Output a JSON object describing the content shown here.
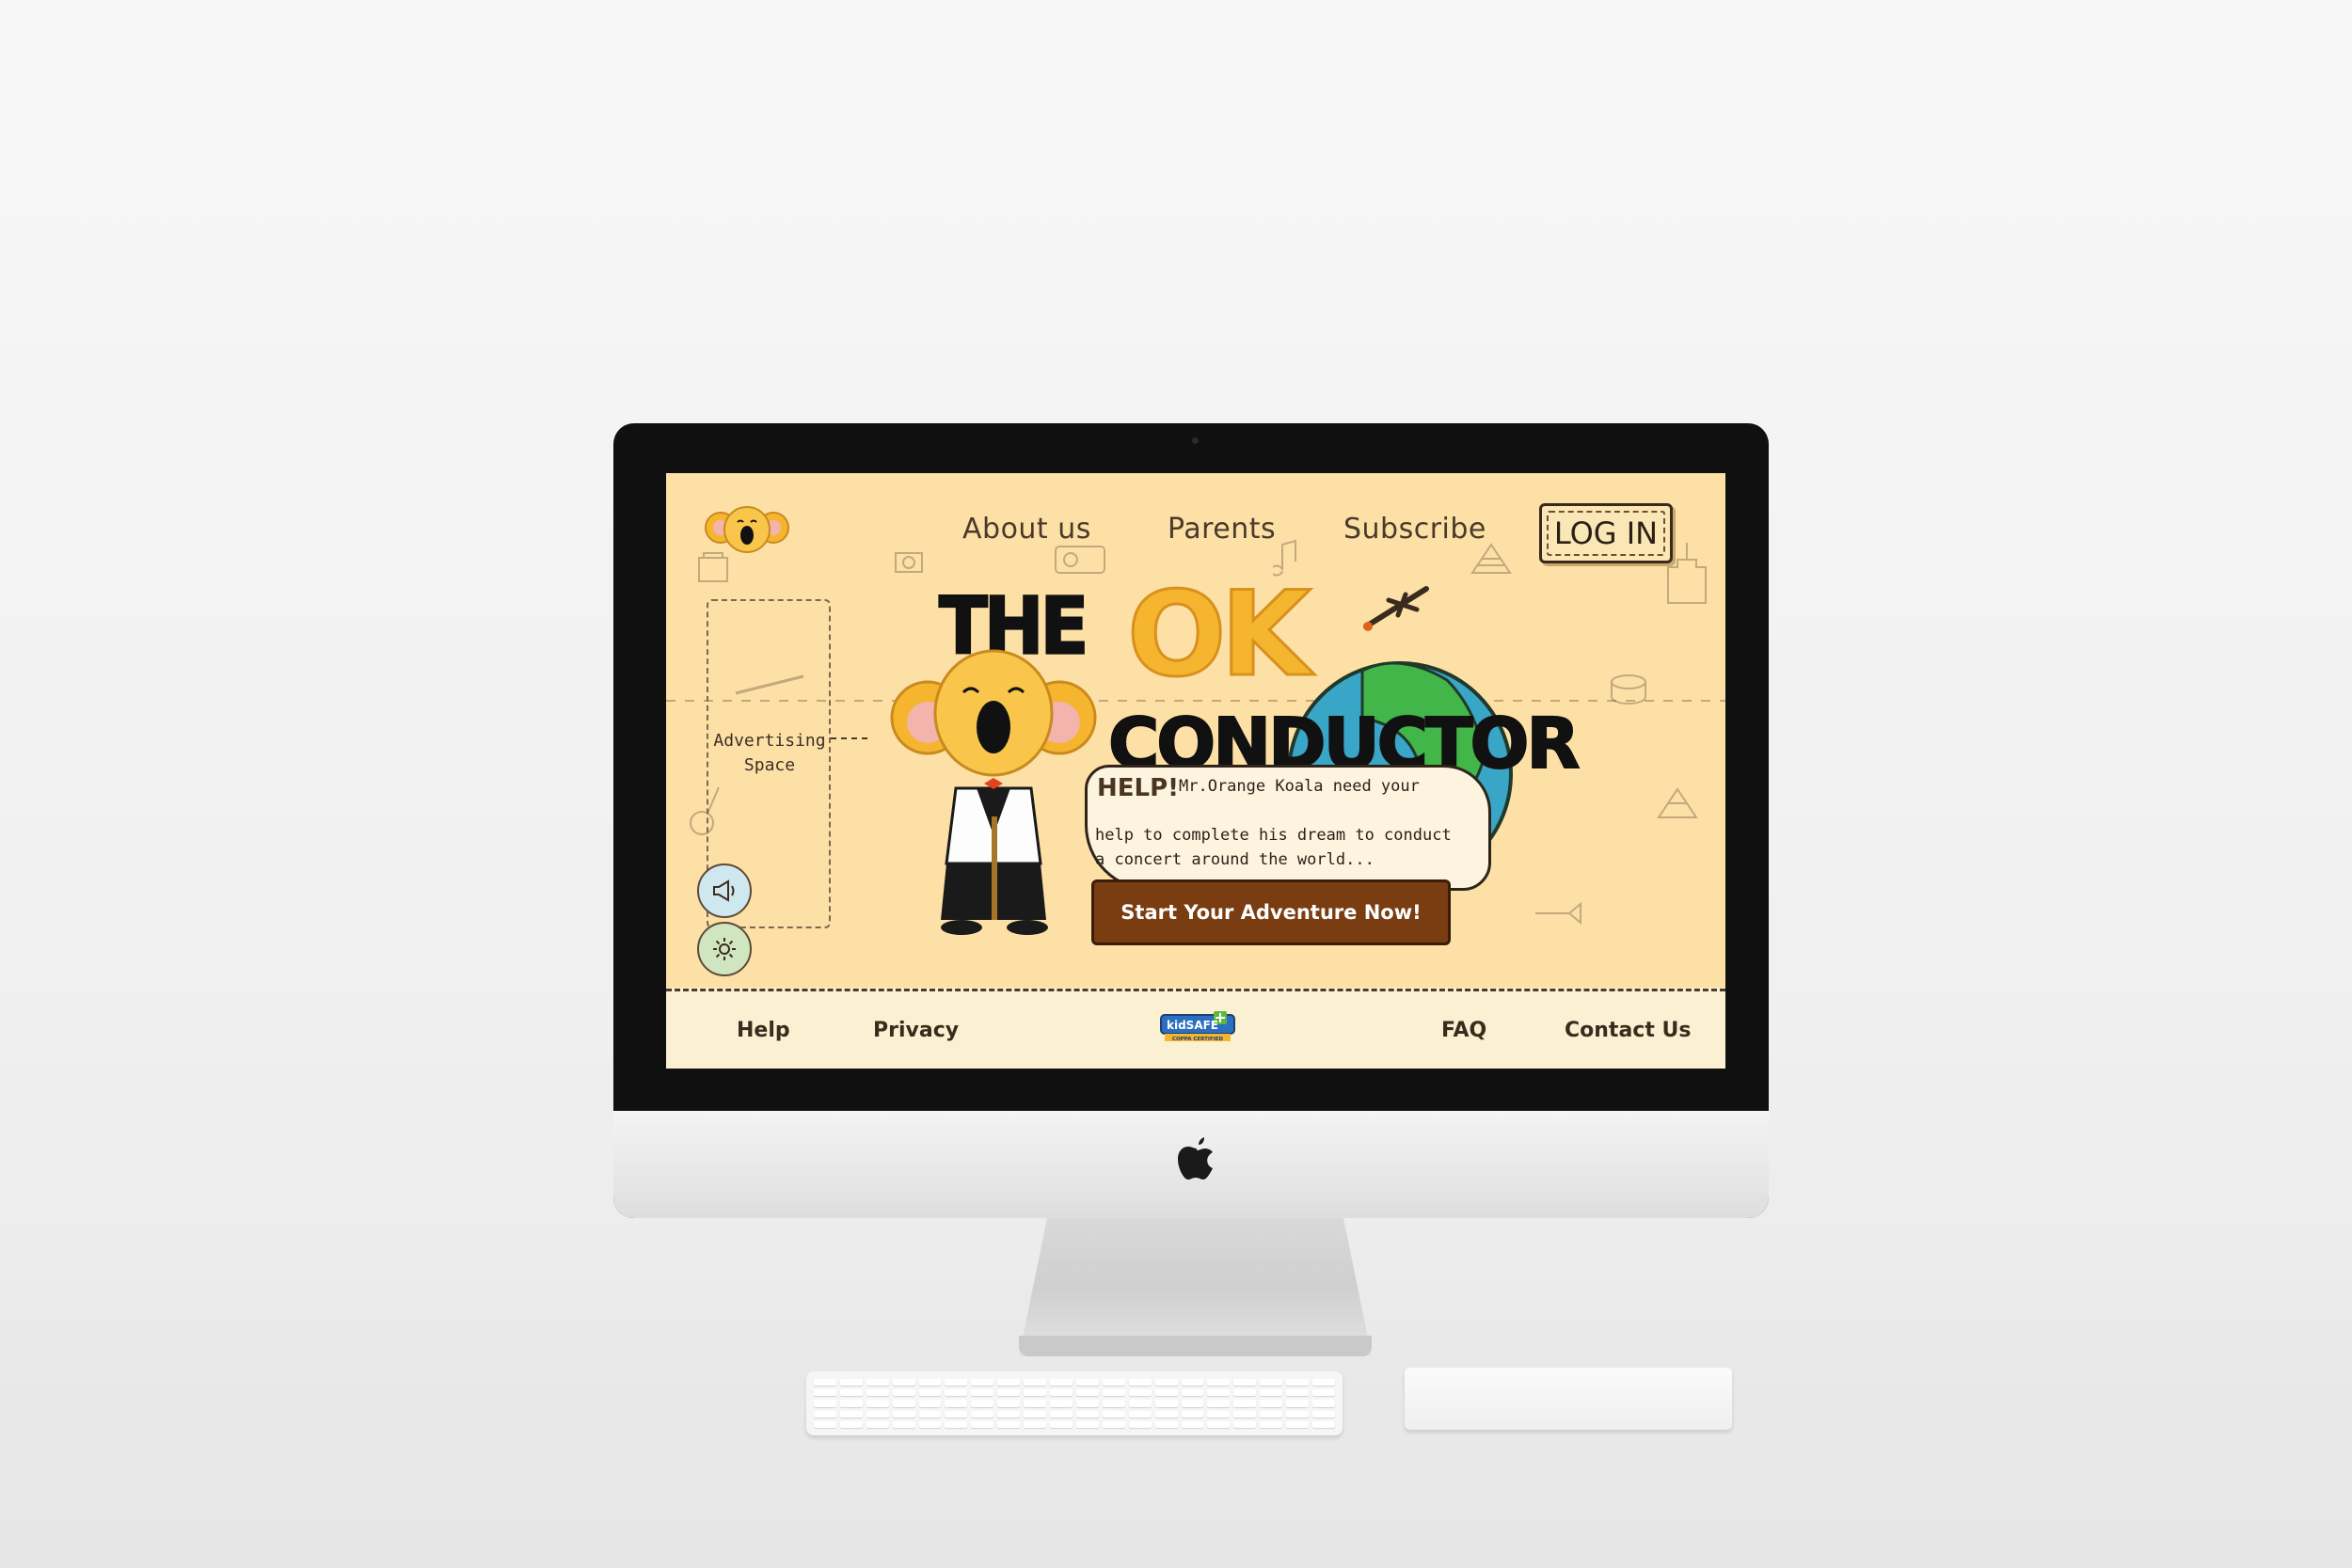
{
  "nav": {
    "about": "About us",
    "parents": "Parents",
    "subscribe": "Subscribe",
    "login": "LOG IN"
  },
  "hero": {
    "title_the": "THE",
    "title_ok": "OK",
    "title_conductor": "CONDUCTOR",
    "help_heading": "HELP!",
    "help_line1": "Mr.Orange Koala need your",
    "help_line2": "help to complete his dream to conduct",
    "help_line3": "a concert around the world...",
    "cta_label": "Start Your Adventure Now!"
  },
  "sidebar": {
    "ad_line1": "Advertising",
    "ad_line2": "Space"
  },
  "footer": {
    "help": "Help",
    "privacy": "Privacy",
    "kidsafe_brand": "kidSAFE",
    "kidsafe_sub": "COPPA CERTIFIED",
    "faq": "FAQ",
    "contact": "Contact Us"
  },
  "icons": [
    "koala-logo-icon",
    "megaphone-icon",
    "gear-icon",
    "airplane-icon",
    "globe-icon",
    "apple-logo-icon"
  ],
  "colors": {
    "screen_bg": "#fde0a6",
    "footer_bg": "#fbf1d2",
    "cta_bg": "#7a3d12",
    "title_ok": "#f6b52e",
    "globe_land": "#43b649",
    "globe_sea": "#39a5c7"
  }
}
